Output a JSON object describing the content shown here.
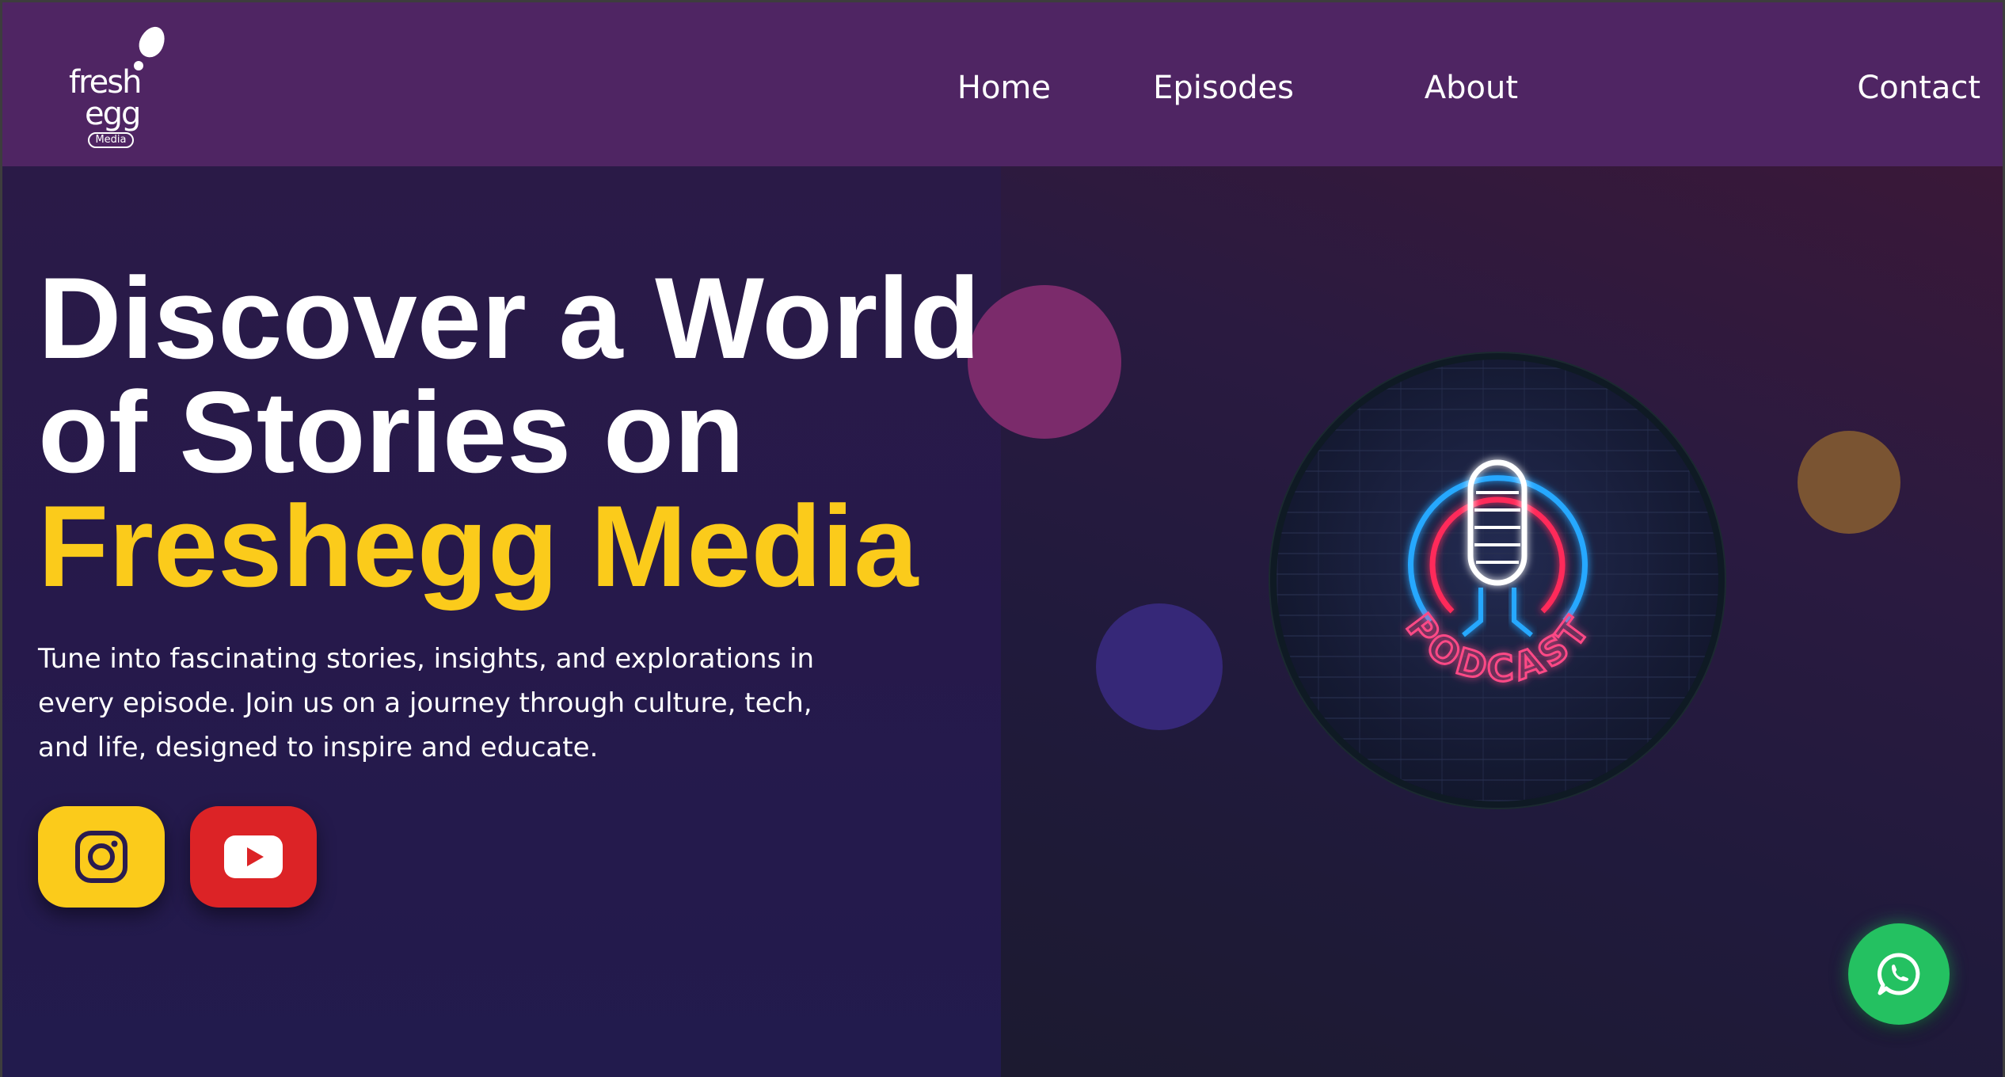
{
  "brand": {
    "logo_line1": "fresh",
    "logo_line2": "egg",
    "logo_badge": "Media"
  },
  "nav": {
    "items": [
      {
        "label": "Home"
      },
      {
        "label": "Episodes"
      },
      {
        "label": "About"
      },
      {
        "label": "Contact"
      }
    ]
  },
  "hero": {
    "headline_line1": "Discover a World",
    "headline_line2": "of Stories on",
    "headline_accent": "Freshegg Media",
    "subtext": "Tune into fascinating stories, insights, and explorations in every episode. Join us on a journey through culture, tech, and life, designed to inspire and educate.",
    "image_sign_text": "PODCAST"
  },
  "social": {
    "instagram_icon": "instagram-icon",
    "youtube_icon": "youtube-icon",
    "whatsapp_icon": "whatsapp-icon"
  },
  "colors": {
    "header_bg": "#4f2563",
    "accent_yellow": "#fbcb1b",
    "youtube_red": "#dc2326",
    "whatsapp_green": "#24c161",
    "deco_pink": "#7b2b6b",
    "deco_blue": "#362878",
    "deco_brown": "#7a5432"
  }
}
